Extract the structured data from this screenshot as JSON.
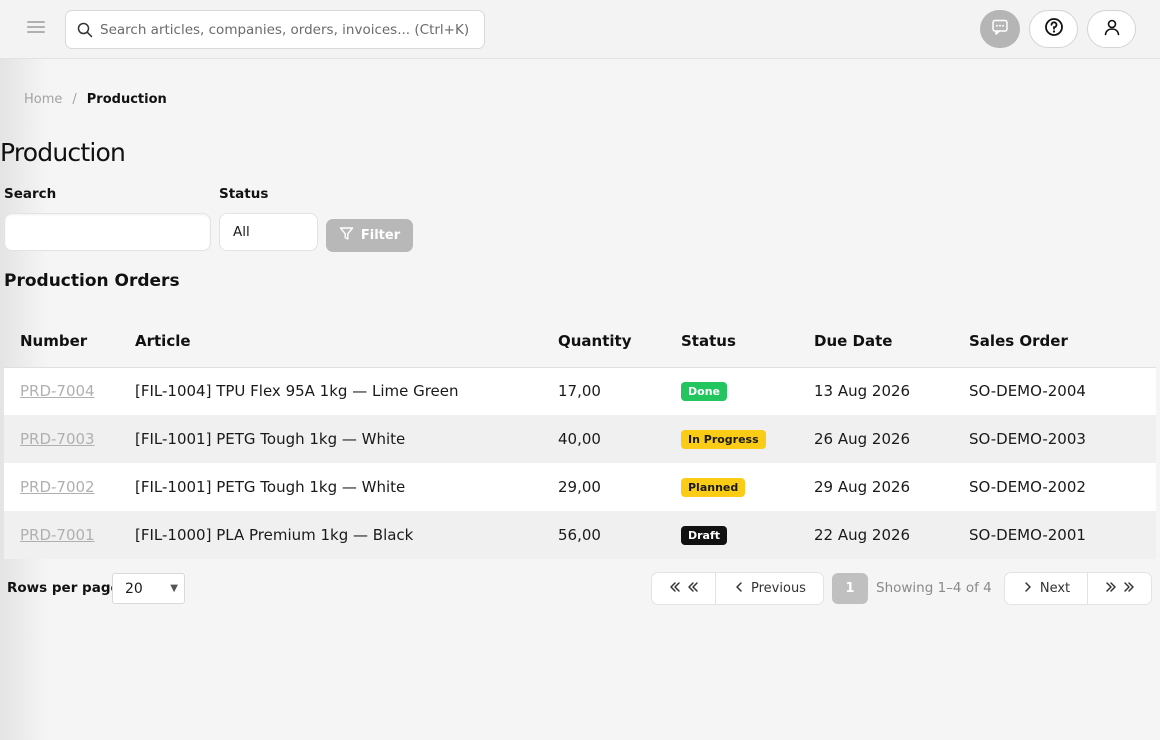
{
  "topbar": {
    "search_placeholder": "Search articles, companies, orders, invoices... (Ctrl+K)"
  },
  "breadcrumb": {
    "home": "Home",
    "separator": "/",
    "current": "Production"
  },
  "page": {
    "title": "Production"
  },
  "filters": {
    "search_label": "Search",
    "search_value": "",
    "status_label": "Status",
    "status_value": "All",
    "filter_button": "Filter"
  },
  "table": {
    "title": "Production Orders",
    "columns": [
      "Number",
      "Article",
      "Quantity",
      "Status",
      "Due Date",
      "Sales Order"
    ],
    "rows": [
      {
        "number": "PRD-7004",
        "article": "[FIL-1004] TPU Flex 95A 1kg — Lime Green",
        "quantity": "17,00",
        "status": "Done",
        "due_date": "13 Aug 2026",
        "sales_order": "SO-DEMO-2004"
      },
      {
        "number": "PRD-7003",
        "article": "[FIL-1001] PETG Tough 1kg — White",
        "quantity": "40,00",
        "status": "In Progress",
        "due_date": "26 Aug 2026",
        "sales_order": "SO-DEMO-2003"
      },
      {
        "number": "PRD-7002",
        "article": "[FIL-1001] PETG Tough 1kg — White",
        "quantity": "29,00",
        "status": "Planned",
        "due_date": "29 Aug 2026",
        "sales_order": "SO-DEMO-2002"
      },
      {
        "number": "PRD-7001",
        "article": "[FIL-1000] PLA Premium 1kg — Black",
        "quantity": "56,00",
        "status": "Draft",
        "due_date": "22 Aug 2026",
        "sales_order": "SO-DEMO-2001"
      }
    ]
  },
  "status_colors": {
    "Done": {
      "bg": "#22c55e",
      "fg": "#ffffff"
    },
    "In Progress": {
      "bg": "#facc15",
      "fg": "#1a1a1a"
    },
    "Planned": {
      "bg": "#facc15",
      "fg": "#1a1a1a"
    },
    "Draft": {
      "bg": "#111111",
      "fg": "#ffffff"
    }
  },
  "pagination": {
    "rows_label": "Rows per page",
    "rows_value": "20",
    "previous": "Previous",
    "next": "Next",
    "current_page": "1",
    "info": "Showing 1–4 of 4"
  },
  "icons": [
    "menu-icon",
    "search-icon",
    "chat-icon",
    "help-icon",
    "user-icon",
    "filter-icon",
    "chevrons-left-icon",
    "chevron-left-icon",
    "chevron-right-icon",
    "chevrons-right-icon"
  ]
}
